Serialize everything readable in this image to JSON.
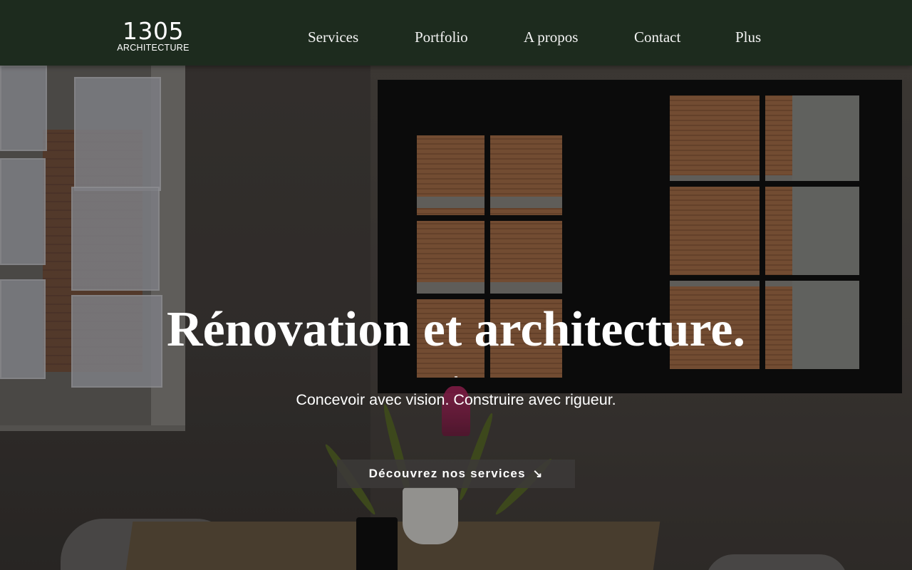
{
  "header": {
    "logo": {
      "number": "1305",
      "subtitle": "ARCHITECTURE"
    },
    "nav": [
      {
        "label": "Services"
      },
      {
        "label": "Portfolio"
      },
      {
        "label": "A propos"
      },
      {
        "label": "Contact"
      },
      {
        "label": "Plus"
      }
    ]
  },
  "hero": {
    "title": "Rénovation et architecture.",
    "dash": "-",
    "subtitle": "Concevoir avec vision. Construire avec rigueur.",
    "cta": {
      "label": "Découvrez nos services",
      "icon": "arrow-down-right-icon",
      "glyph": "↘"
    }
  },
  "colors": {
    "header_bg": "#1d2b1e",
    "text": "#ffffff",
    "cta_bg": "#3c3a38"
  }
}
